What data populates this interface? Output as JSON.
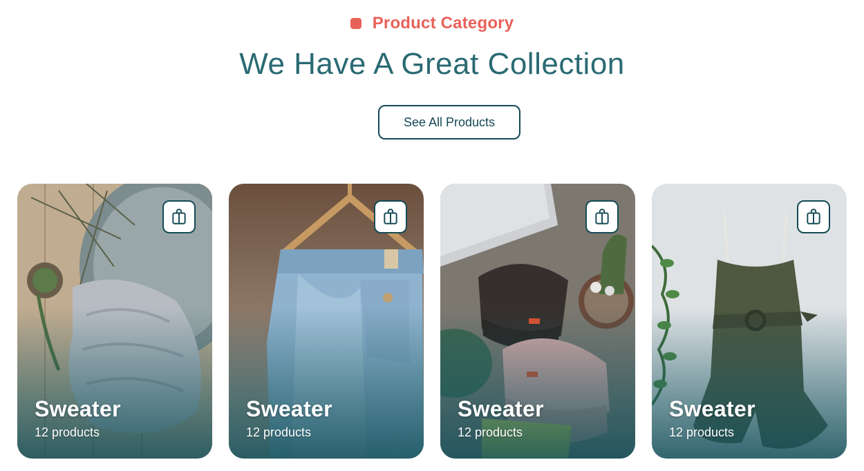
{
  "header": {
    "eyebrow": "Product Category",
    "title": "We Have A Great Collection",
    "cta_label": "See All Products"
  },
  "colors": {
    "accent": "#e8625a",
    "brand": "#2a6a73",
    "button_border": "#144a55"
  },
  "cards": [
    {
      "name": "Sweater",
      "count": "12 products",
      "icon": "bag-icon",
      "image": "knit-sweater-photo"
    },
    {
      "name": "Sweater",
      "count": "12 products",
      "icon": "bag-icon",
      "image": "jeans-on-hanger-photo"
    },
    {
      "name": "Sweater",
      "count": "12 products",
      "icon": "bag-icon",
      "image": "beanies-photo"
    },
    {
      "name": "Sweater",
      "count": "12 products",
      "icon": "bag-icon",
      "image": "romper-photo"
    }
  ]
}
